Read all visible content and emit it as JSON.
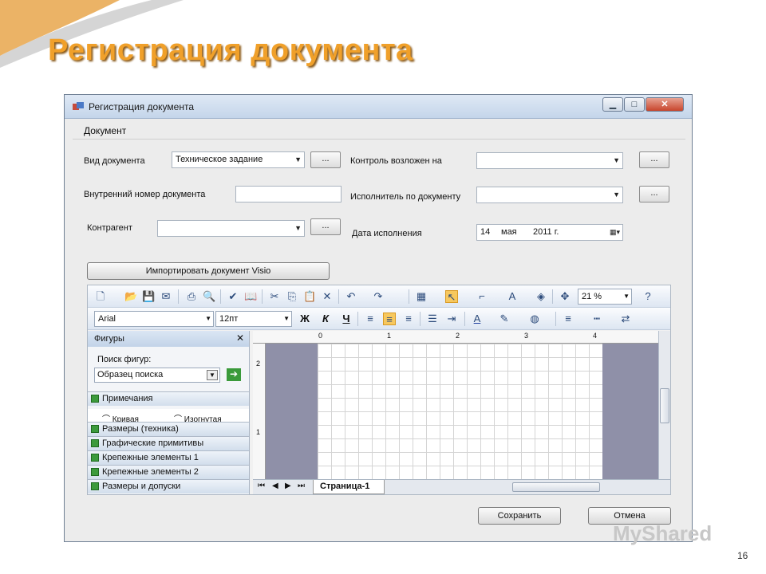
{
  "slide": {
    "title": "Регистрация документа",
    "page_number": "16",
    "watermark": "MyShared"
  },
  "window": {
    "title": "Регистрация документа",
    "buttons": {
      "minimize": "▁",
      "maximize": "□",
      "close": "✕"
    },
    "menu": [
      "Документ"
    ]
  },
  "form": {
    "doc_type": {
      "label": "Вид документа",
      "value": "Техническое задание",
      "browse": "..."
    },
    "internal_number": {
      "label": "Внутренний номер документа",
      "value": ""
    },
    "counterparty": {
      "label": "Контрагент",
      "value": "",
      "browse": "..."
    },
    "control": {
      "label": "Контроль возложен на",
      "value": "",
      "browse": "..."
    },
    "executor": {
      "label": "Исполнитель по документу",
      "value": "",
      "browse": "..."
    },
    "due_date": {
      "label": "Дата исполнения",
      "day": "14",
      "month": "мая",
      "year": "2011 г."
    },
    "import_button": "Импортировать документ Visio",
    "save_button": "Сохранить",
    "cancel_button": "Отмена"
  },
  "visio": {
    "zoom": "21 %",
    "font": "Arial",
    "font_size": "12пт",
    "bold": "Ж",
    "italic": "К",
    "underline": "Ч",
    "shapes_pane": {
      "title": "Фигуры",
      "search_label": "Поиск фигур:",
      "search_placeholder": "Образец поиска",
      "stencil_top": "Примечания",
      "stencil_items": [
        "Кривая",
        "Изогнутая"
      ],
      "stencils": [
        "Размеры (техника)",
        "Графические примитивы",
        "Крепежные элементы 1",
        "Крепежные элементы 2",
        "Размеры и допуски"
      ]
    },
    "ruler_h": [
      "0",
      "1",
      "2",
      "3",
      "4"
    ],
    "ruler_v": [
      "2",
      "1"
    ],
    "page_tab": "Страница-1"
  },
  "colors": {
    "title": "#f0a02a",
    "canvas_bg": "#8f90a8",
    "accent": "#f7c85e"
  }
}
